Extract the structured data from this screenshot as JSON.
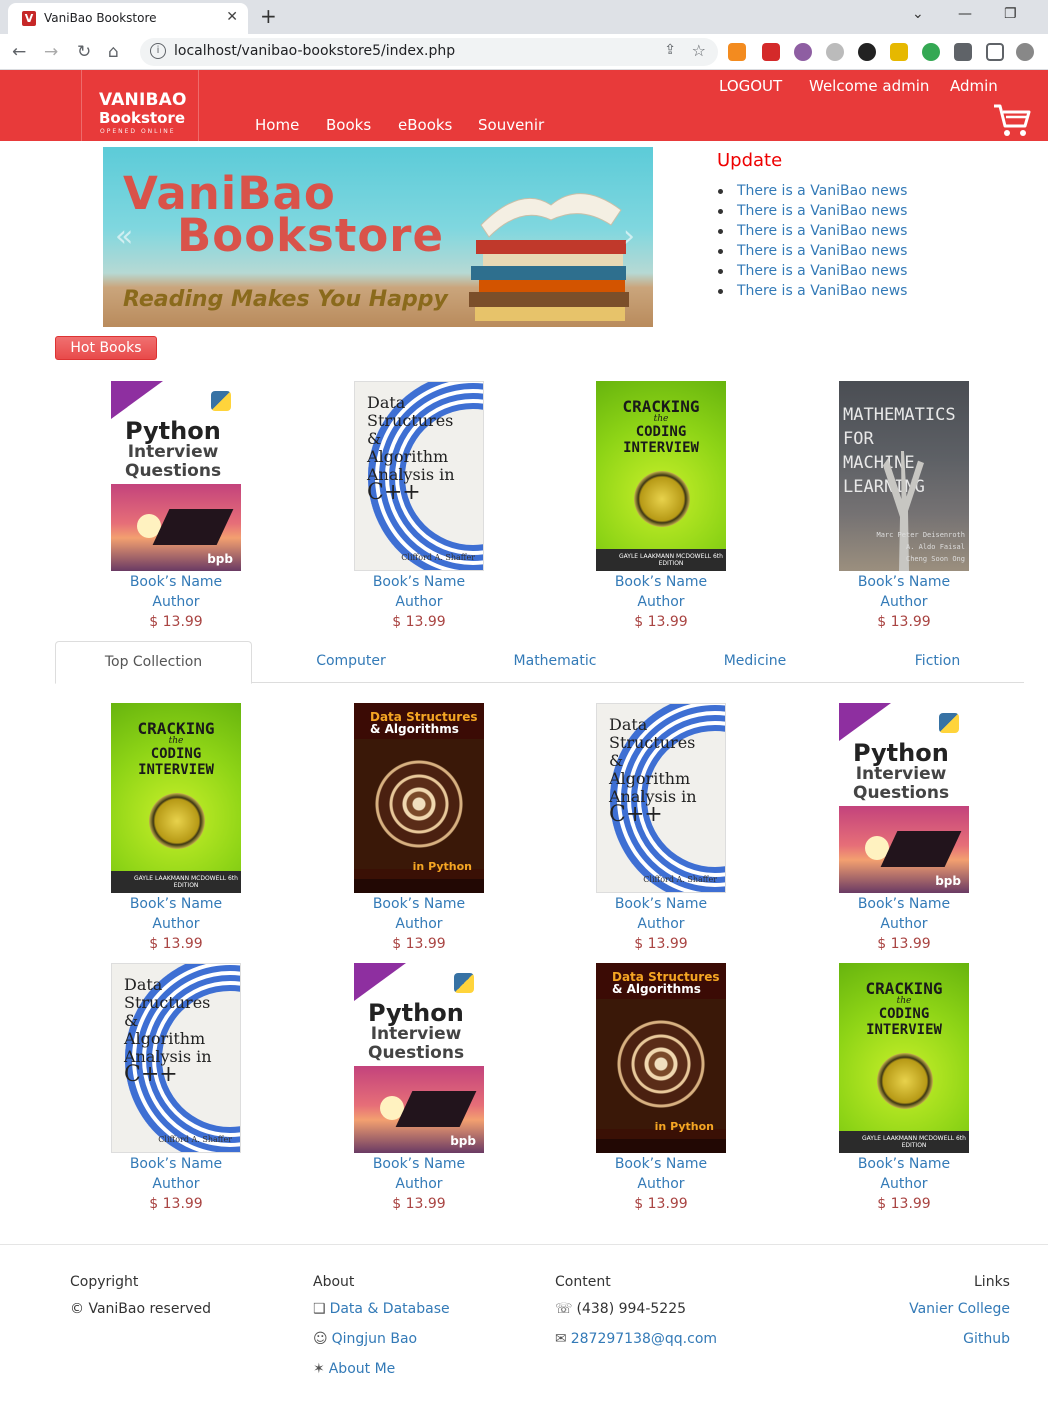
{
  "browser": {
    "tab_title": "VaniBao Bookstore",
    "tab_close": "✕",
    "new_tab": "+",
    "url": "localhost/vanibao-bookstore5/index.php"
  },
  "header": {
    "brand_line1": "VANIBAO",
    "brand_line2": "Bookstore",
    "brand_line3": "OPENED ONLINE",
    "logout": "LOGOUT",
    "welcome": "Welcome admin",
    "admin": "Admin",
    "nav": [
      "Home",
      "Books",
      "eBooks",
      "Souvenir"
    ],
    "colors": {
      "primary": "#e83a3a",
      "link": "#337ab7",
      "price": "#a94442"
    }
  },
  "banner": {
    "title1": "VaniBao",
    "title2": "Bookstore",
    "tagline": "Reading Makes You Happy"
  },
  "update": {
    "title": "Update",
    "items": [
      "There is a VaniBao news",
      "There is a VaniBao news",
      "There is a VaniBao news",
      "There is a VaniBao news",
      "There is a VaniBao news",
      "There is a VaniBao news"
    ]
  },
  "hot": {
    "label": "Hot Books",
    "books": [
      {
        "name": "Book’s Name",
        "author": "Author",
        "price": "$ 13.99",
        "cover": "python-interview-questions"
      },
      {
        "name": "Book’s Name",
        "author": "Author",
        "price": "$ 13.99",
        "cover": "data-structures-cpp"
      },
      {
        "name": "Book’s Name",
        "author": "Author",
        "price": "$ 13.99",
        "cover": "cracking-coding-interview"
      },
      {
        "name": "Book’s Name",
        "author": "Author",
        "price": "$ 13.99",
        "cover": "mathematics-machine-learning"
      }
    ]
  },
  "tabs": [
    "Top Collection",
    "Computer",
    "Mathematic",
    "Medicine",
    "Fiction"
  ],
  "collection": [
    {
      "name": "Book’s Name",
      "author": "Author",
      "price": "$ 13.99",
      "cover": "cracking-coding-interview"
    },
    {
      "name": "Book’s Name",
      "author": "Author",
      "price": "$ 13.99",
      "cover": "data-structures-python"
    },
    {
      "name": "Book’s Name",
      "author": "Author",
      "price": "$ 13.99",
      "cover": "data-structures-cpp"
    },
    {
      "name": "Book’s Name",
      "author": "Author",
      "price": "$ 13.99",
      "cover": "python-interview-questions"
    },
    {
      "name": "Book’s Name",
      "author": "Author",
      "price": "$ 13.99",
      "cover": "data-structures-cpp"
    },
    {
      "name": "Book’s Name",
      "author": "Author",
      "price": "$ 13.99",
      "cover": "python-interview-questions"
    },
    {
      "name": "Book’s Name",
      "author": "Author",
      "price": "$ 13.99",
      "cover": "data-structures-python"
    },
    {
      "name": "Book’s Name",
      "author": "Author",
      "price": "$ 13.99",
      "cover": "cracking-coding-interview"
    }
  ],
  "cover_text": {
    "python": {
      "t1": "Python",
      "t2": "Interview",
      "t3": "Questions",
      "pub": "bpb"
    },
    "ds": {
      "l1": "Data",
      "l2": "Structures",
      "l3": "&",
      "l4": "Algorithm",
      "l5": "Analysis in",
      "l6": "C++",
      "author": "Clifford A. Shaffer"
    },
    "crack": {
      "t1": "CRACKING",
      "the": "the",
      "t2": "CODING INTERVIEW",
      "strip": "GAYLE LAAKMANN MCDOWELL 6th EDITION"
    },
    "math": {
      "l1": "MATHEMATICS FOR",
      "l2": "MACHINE LEARNING",
      "a1": "Marc Peter Deisenroth",
      "a2": "A. Aldo Faisal",
      "a3": "Cheng Soon Ong"
    },
    "dspy": {
      "l1": "Data Structures",
      "l2": "& Algorithms",
      "l3": "in Python"
    }
  },
  "footer": {
    "copyright_h": "Copyright",
    "copyright": "© VaniBao reserved",
    "about_h": "About",
    "about": [
      {
        "icon": "❑",
        "text": "Data & Database"
      },
      {
        "icon": "☺",
        "text": "Qingjun Bao"
      },
      {
        "icon": "✶",
        "text": "About Me"
      }
    ],
    "content_h": "Content",
    "phone_icon": "☏",
    "phone": "(438) 994-5225",
    "email_icon": "✉",
    "email": "287297138@qq.com",
    "links_h": "Links",
    "links": [
      "Vanier College",
      "Github"
    ]
  }
}
